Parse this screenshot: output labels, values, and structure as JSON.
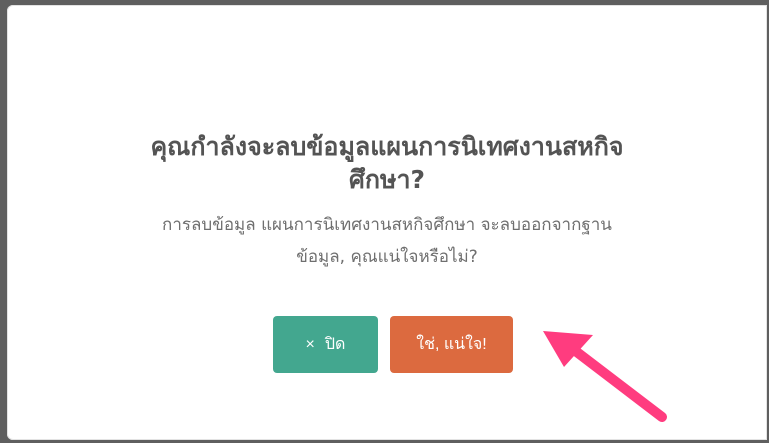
{
  "dialog": {
    "title_line1": "คุณกำลังจะลบข้อมูลแผนการนิเทศงานสหกิจ",
    "title_line2": "ศึกษา?",
    "message_line1": "การลบข้อมูล แผนการนิเทศงานสหกิจศึกษา จะลบออกจากฐาน",
    "message_line2": "ข้อมูล, คุณแน่ใจหรือไม่?"
  },
  "buttons": {
    "close_icon": "×",
    "close_label": "ปิด",
    "confirm_label": "ใช่, แน่ใจ!"
  },
  "colors": {
    "close_button": "#43a78f",
    "confirm_button": "#dc6a3f",
    "arrow": "#ff3c7f"
  },
  "icons": {
    "close": "close-icon",
    "pointer": "annotation-arrow-icon"
  }
}
